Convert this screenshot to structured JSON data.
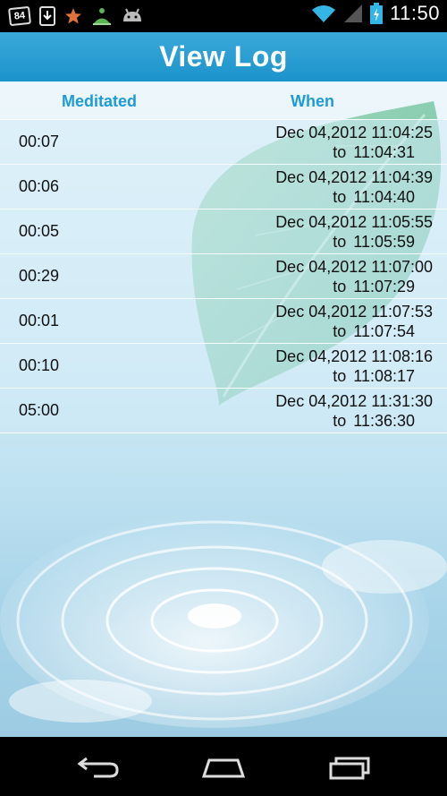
{
  "status_bar": {
    "notification_badge": "84",
    "icons": [
      "download-icon",
      "star-icon",
      "meditation-app-icon",
      "android-icon"
    ],
    "right_icons": [
      "wifi-icon",
      "signal-icon",
      "battery-charging-icon"
    ],
    "time": "11:50"
  },
  "title": "View Log",
  "table": {
    "headers": {
      "meditated": "Meditated",
      "when": "When"
    },
    "to_word": "to",
    "rows": [
      {
        "duration": "00:07",
        "start": "Dec 04,2012 11:04:25",
        "end": "11:04:31"
      },
      {
        "duration": "00:06",
        "start": "Dec 04,2012 11:04:39",
        "end": "11:04:40"
      },
      {
        "duration": "00:05",
        "start": "Dec 04,2012 11:05:55",
        "end": "11:05:59"
      },
      {
        "duration": "00:29",
        "start": "Dec 04,2012 11:07:00",
        "end": "11:07:29"
      },
      {
        "duration": "00:01",
        "start": "Dec 04,2012 11:07:53",
        "end": "11:07:54"
      },
      {
        "duration": "00:10",
        "start": "Dec 04,2012 11:08:16",
        "end": "11:08:17"
      },
      {
        "duration": "05:00",
        "start": "Dec 04,2012 11:31:30",
        "end": "11:36:30"
      }
    ]
  },
  "nav_bar": [
    "back-icon",
    "home-icon",
    "recent-apps-icon"
  ],
  "colors": {
    "title_bar": "#1c93cc",
    "header_text": "#1e9bd6",
    "row_text": "#111111"
  }
}
